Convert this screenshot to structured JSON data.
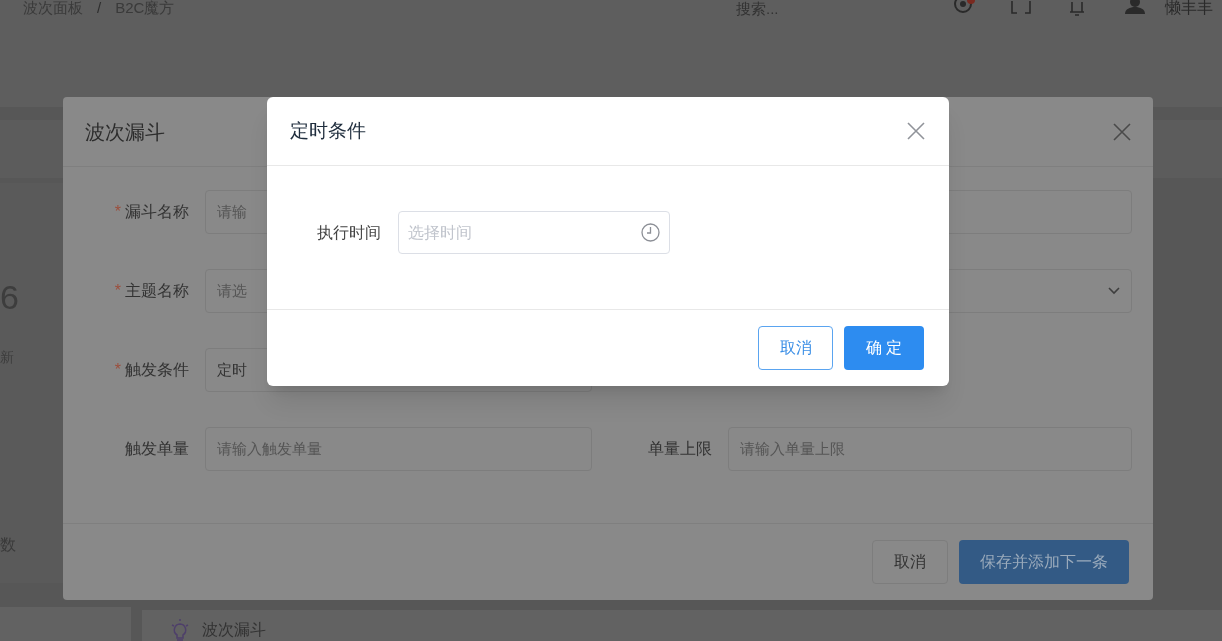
{
  "background": {
    "breadcrumbs": [
      "波次面板",
      "B2C魔方"
    ],
    "breadcrumb_separator": "/",
    "search_placeholder": "搜索...",
    "user_name": "懒丰丰",
    "side_texts": [
      "6",
      "新",
      "数"
    ],
    "bottom_card_title": "波次漏斗"
  },
  "outer_dialog": {
    "title": "波次漏斗",
    "rows": [
      [
        {
          "label": "漏斗名称",
          "required_mark": "*",
          "kind": "input",
          "placeholder": "请输"
        }
      ],
      [
        {
          "label": "主题名称",
          "required_mark": "*",
          "kind": "select",
          "placeholder": "请选"
        }
      ],
      [
        {
          "label": "触发条件",
          "required_mark": "*",
          "kind": "input",
          "value": "定时",
          "half": true
        }
      ],
      [
        {
          "label": "触发单量",
          "kind": "input",
          "placeholder": "请输入触发单量"
        },
        {
          "label": "单量上限",
          "kind": "input",
          "placeholder": "请输入单量上限"
        }
      ]
    ],
    "buttons": [
      {
        "label": "取消",
        "kind": "default"
      },
      {
        "label": "保存并添加下一条",
        "kind": "primary"
      }
    ]
  },
  "inner_dialog": {
    "title": "定时条件",
    "field": {
      "label": "执行时间",
      "placeholder": "选择时间"
    },
    "buttons": [
      {
        "label": "取消",
        "kind": "default"
      },
      {
        "label": "确 定",
        "kind": "primary"
      }
    ]
  }
}
